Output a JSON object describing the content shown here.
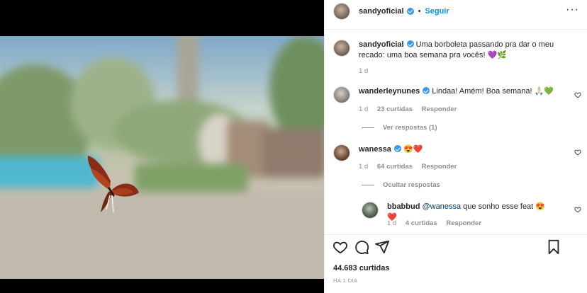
{
  "post": {
    "author": "sandyoficial",
    "follow_label": "Seguir",
    "separator": "•",
    "more_label": "···",
    "caption": "Uma borboleta passando pra dar o meu recado: uma boa semana pra vocês! 💜🌿",
    "caption_time": "1 d",
    "likes": "44.683 curtidas",
    "posted_ago": "HÁ 1 DIA"
  },
  "comments": [
    {
      "user": "wanderleynunes",
      "text": "Lindaa! Amém! Boa semana! 🙏🏻💚",
      "time": "1 d",
      "likes": "23 curtidas",
      "reply_label": "Responder",
      "replies_toggle": "Ver respostas (1)"
    },
    {
      "user": "wanessa",
      "text": "😍❤️",
      "time": "1 d",
      "likes": "64 curtidas",
      "reply_label": "Responder",
      "replies_toggle": "Ocultar respostas",
      "replies": [
        {
          "user": "bbabbud",
          "mention": "@wanessa",
          "text": "que sonho esse feat 😍❤️",
          "time": "1 d",
          "likes": "4 curtidas",
          "reply_label": "Responder"
        }
      ]
    }
  ],
  "icons": {
    "like": "heart-icon",
    "comment": "comment-icon",
    "share": "paper-plane-icon",
    "save": "bookmark-icon",
    "verified": "verified-badge-icon"
  },
  "colors": {
    "accent": "#0095f6",
    "verified": "#3897f0",
    "muted": "#8e8e8e"
  }
}
